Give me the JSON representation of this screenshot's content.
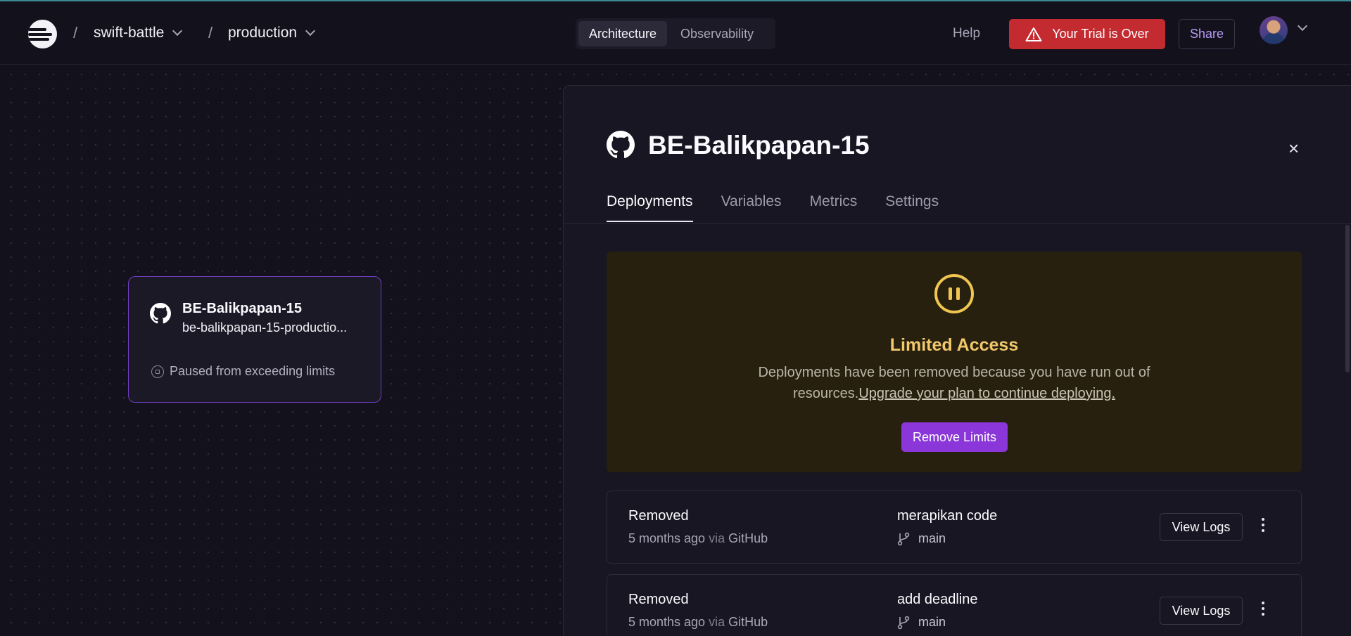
{
  "header": {
    "project": "swift-battle",
    "environment": "production",
    "separator": "/",
    "views": [
      {
        "label": "Architecture",
        "active": true
      },
      {
        "label": "Observability",
        "active": false
      }
    ],
    "help_label": "Help",
    "trial_label": "Your Trial is Over",
    "share_label": "Share"
  },
  "node": {
    "title": "BE-Balikpapan-15",
    "subtitle": "be-balikpapan-15-productio...",
    "status": "Paused from exceeding limits"
  },
  "panel": {
    "title": "BE-Balikpapan-15",
    "close_label": "×",
    "tabs": [
      {
        "label": "Deployments",
        "active": true
      },
      {
        "label": "Variables",
        "active": false
      },
      {
        "label": "Metrics",
        "active": false
      },
      {
        "label": "Settings",
        "active": false
      }
    ],
    "banner": {
      "title": "Limited Access",
      "text": "Deployments have been removed because you have run out of resources.",
      "link": "Upgrade your plan to continue deploying.",
      "button": "Remove Limits"
    },
    "deployments": [
      {
        "status": "Removed",
        "time": "5 months ago",
        "via": "via",
        "source": "GitHub",
        "message": "merapikan code",
        "branch": "main",
        "logs_label": "View Logs"
      },
      {
        "status": "Removed",
        "time": "5 months ago",
        "via": "via",
        "source": "GitHub",
        "message": "add deadline",
        "branch": "main",
        "logs_label": "View Logs"
      }
    ]
  },
  "colors": {
    "accent": "#8a36d8",
    "danger": "#c42b30",
    "warning": "#f0c550",
    "background": "#13111c"
  }
}
